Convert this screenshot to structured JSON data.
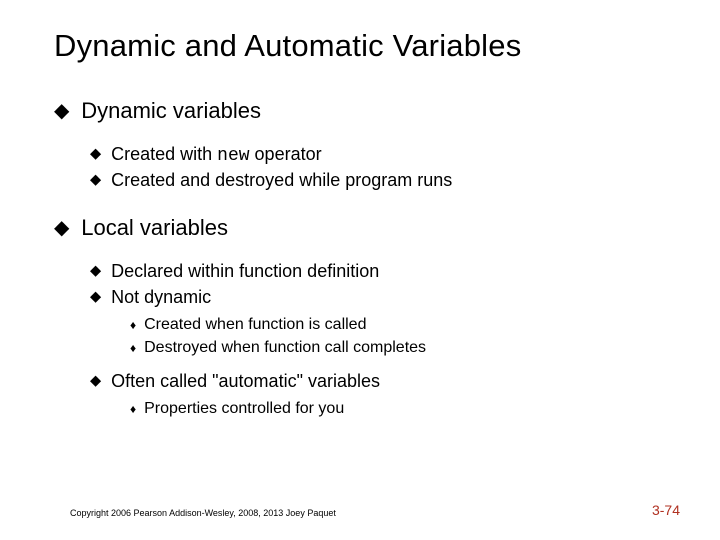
{
  "title": "Dynamic and Automatic Variables",
  "sec1": {
    "heading": "Dynamic variables",
    "b1_pre": "Created with ",
    "b1_code": "new",
    "b1_post": " operator",
    "b2": "Created and destroyed while program runs"
  },
  "sec2": {
    "heading": "Local variables",
    "b1": "Declared within function definition",
    "b2": "Not dynamic",
    "b2a": "Created when function is called",
    "b2b": "Destroyed when function call completes",
    "b3": "Often called \"automatic\" variables",
    "b3a": "Properties controlled for you"
  },
  "footer": {
    "copyright": "Copyright 2006 Pearson Addison-Wesley, 2008, 2013 Joey Paquet",
    "pagenum": "3-74"
  }
}
